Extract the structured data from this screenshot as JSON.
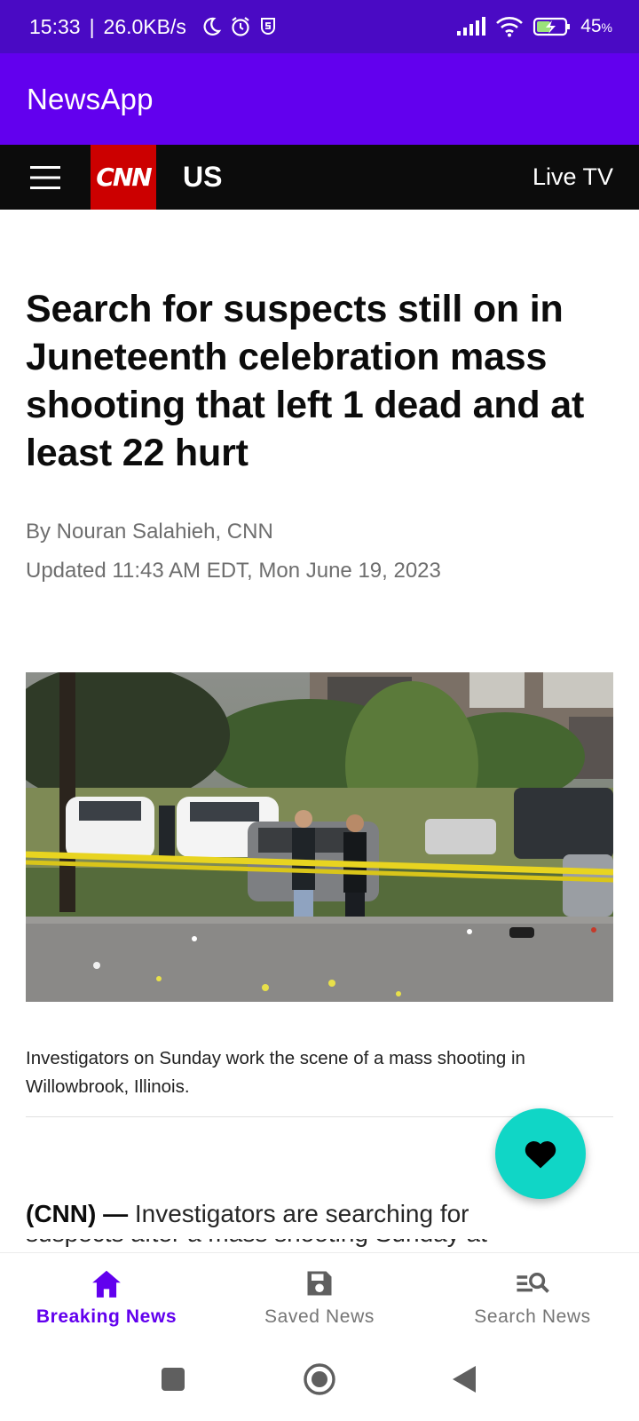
{
  "status_bar": {
    "time": "15:33",
    "net_speed": "26.0KB/s",
    "battery_pct": "45",
    "battery_unit": "%"
  },
  "app_bar": {
    "title": "NewsApp"
  },
  "cnn_header": {
    "logo": "CNN",
    "edition": "US",
    "live_tv": "Live TV"
  },
  "article": {
    "headline": "Search for suspects still on in Juneteenth celebration mass shooting that left 1 dead and at least 22 hurt",
    "byline": "By Nouran Salahieh, CNN",
    "updated": "Updated 11:43 AM EDT, Mon June 19, 2023",
    "image_caption": "Investigators on Sunday work the scene of a mass shooting in Willowbrook, Illinois.",
    "lead_source": "(CNN) —",
    "lead_text": "Investigators are searching for",
    "lead_next_line": "suspects after a mass shooting Sunday at"
  },
  "fab": {
    "icon": "heart-icon"
  },
  "bottom_nav": {
    "items": [
      {
        "label": "Breaking News",
        "icon": "home-icon",
        "active": true
      },
      {
        "label": "Saved News",
        "icon": "save-icon",
        "active": false
      },
      {
        "label": "Search News",
        "icon": "search-list-icon",
        "active": false
      }
    ]
  },
  "colors": {
    "status_bar": "#4a0ac4",
    "app_bar": "#6200ee",
    "cnn_red": "#cc0000",
    "fab": "#10d6c6",
    "active_tab": "#6200ee"
  }
}
